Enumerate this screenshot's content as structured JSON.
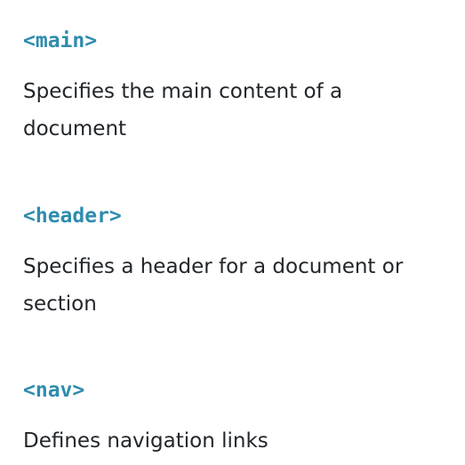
{
  "entries": [
    {
      "tag": "<main>",
      "description": "Specifies the main content of a document"
    },
    {
      "tag": "<header>",
      "description": "Specifies a header for a document or section"
    },
    {
      "tag": "<nav>",
      "description": "Defines navigation links"
    }
  ],
  "colors": {
    "tag": "#2f8cae",
    "text": "#22262b",
    "background": "#ffffff"
  }
}
